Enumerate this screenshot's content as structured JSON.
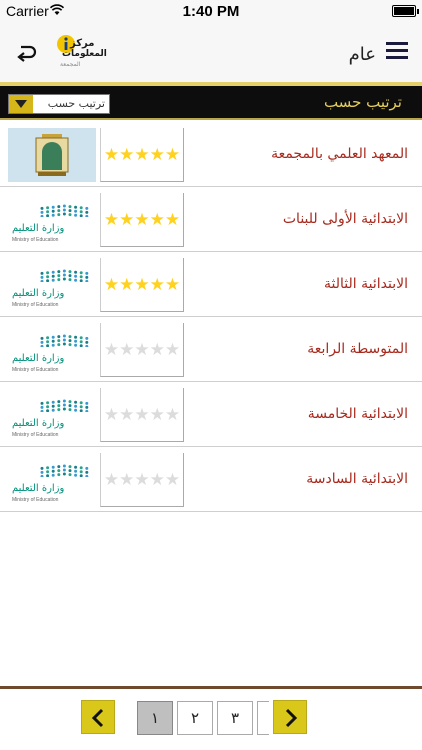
{
  "status": {
    "carrier": "Carrier",
    "time": "1:40 PM"
  },
  "nav": {
    "title": "عام",
    "logo": {
      "line1": "مركز",
      "line2": "المعلومات",
      "line3": "المجمعة"
    }
  },
  "sort": {
    "label": "ترتيب حسب",
    "select_value": "ترتيب حسب"
  },
  "schools": [
    {
      "name": "المعهد العلمي بالمجمعة",
      "rating": 5,
      "logo": "imsiu-logo"
    },
    {
      "name": "الابتدائية الأولى للبنات",
      "rating": 5,
      "logo": "ministry-of-education-logo"
    },
    {
      "name": "الابتدائية الثالثة",
      "rating": 5,
      "logo": "ministry-of-education-logo"
    },
    {
      "name": "المتوسطة الرابعة",
      "rating": 0,
      "logo": "ministry-of-education-logo"
    },
    {
      "name": "الابتدائية الخامسة",
      "rating": 0,
      "logo": "ministry-of-education-logo"
    },
    {
      "name": "الابتدائية السادسة",
      "rating": 0,
      "logo": "ministry-of-education-logo"
    }
  ],
  "moe_logo": {
    "arabic": "وزارة التعليم",
    "english": "Ministry of Education"
  },
  "pager": {
    "pages": [
      "١",
      "٢",
      "٣"
    ],
    "active_index": 0
  },
  "colors": {
    "accent_yellow": "#d9c71a",
    "title_red": "#a82a1e",
    "star_yellow": "#ffd21f",
    "bar_black": "#0d0d0d"
  }
}
